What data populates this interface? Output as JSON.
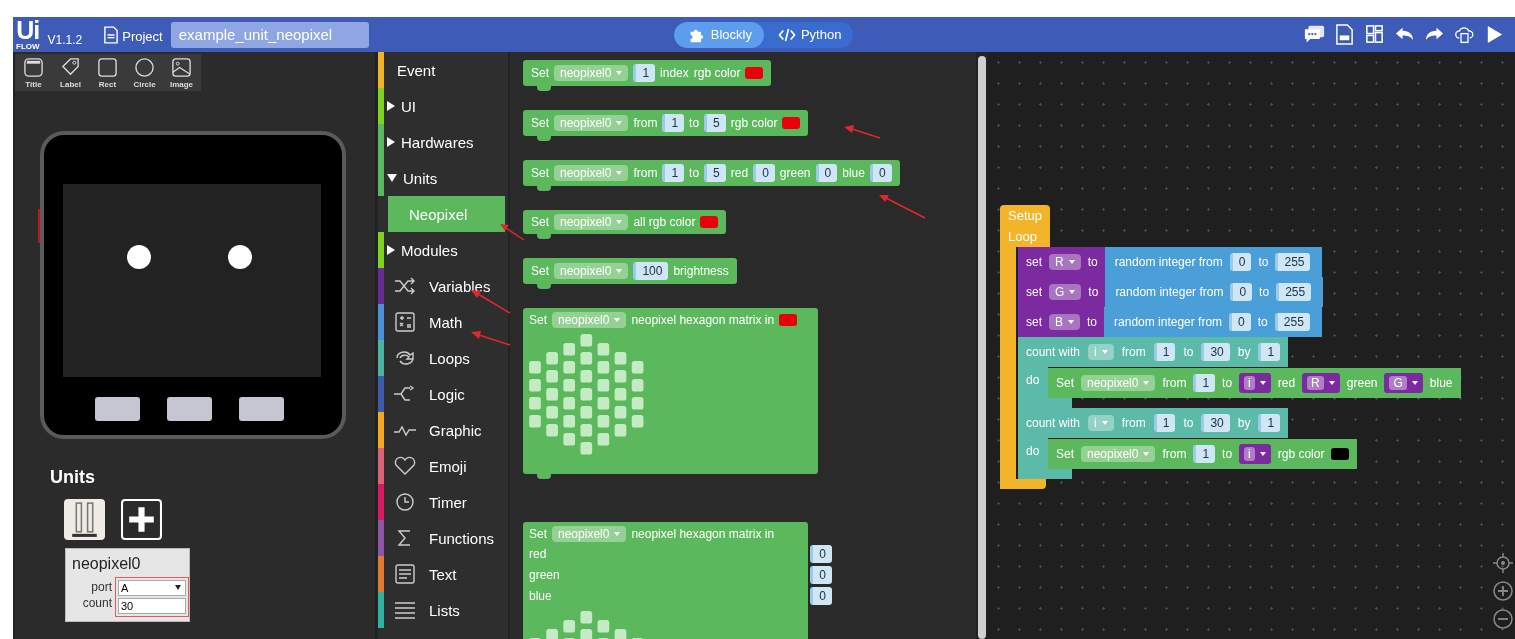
{
  "header": {
    "logo": "Ui",
    "logo_sub": "FLOW",
    "version": "V1.1.2",
    "project_label": "Project",
    "project_name": "example_unit_neopixel",
    "modes": [
      {
        "label": "Blockly",
        "selected": true
      },
      {
        "label": "Python",
        "selected": false
      }
    ]
  },
  "tools": [
    {
      "label": "Title"
    },
    {
      "label": "Label"
    },
    {
      "label": "Rect"
    },
    {
      "label": "Circle"
    },
    {
      "label": "Image"
    }
  ],
  "units": {
    "title": "Units",
    "unit": {
      "name": "neopixel0",
      "port_label": "port",
      "port": "A",
      "count_label": "count",
      "count": "30"
    }
  },
  "categories": [
    {
      "label": "Event",
      "kind": "plain",
      "color": "#f0b429",
      "selected": false
    },
    {
      "label": "UI",
      "kind": "folder",
      "expanded": false,
      "color": "#7ed321",
      "selected": false
    },
    {
      "label": "Hardwares",
      "kind": "folder",
      "expanded": false,
      "color": "#5cb85c",
      "selected": false
    },
    {
      "label": "Units",
      "kind": "folder",
      "expanded": true,
      "color": "#5cb85c",
      "selected": false,
      "children": [
        {
          "label": "Neopixel",
          "selected": true
        }
      ]
    },
    {
      "label": "Modules",
      "kind": "folder",
      "expanded": false,
      "color": "#7ed321",
      "selected": false
    },
    {
      "label": "Variables",
      "kind": "icon",
      "color": "#6a2a94",
      "selected": false
    },
    {
      "label": "Math",
      "kind": "icon",
      "color": "#4a90d9",
      "selected": false
    },
    {
      "label": "Loops",
      "kind": "icon",
      "color": "#4fb3a3",
      "selected": false
    },
    {
      "label": "Logic",
      "kind": "icon",
      "color": "#3e5aa8",
      "selected": false
    },
    {
      "label": "Graphic",
      "kind": "icon",
      "color": "#f5a623",
      "selected": false
    },
    {
      "label": "Emoji",
      "kind": "icon",
      "color": "#d9647a",
      "selected": false
    },
    {
      "label": "Timer",
      "kind": "icon",
      "color": "#d81b60",
      "selected": false
    },
    {
      "label": "Functions",
      "kind": "icon",
      "color": "#8e55a8",
      "selected": false
    },
    {
      "label": "Text",
      "kind": "icon",
      "color": "#e07a30",
      "selected": false
    },
    {
      "label": "Lists",
      "kind": "icon",
      "color": "#2db3a0",
      "selected": false
    }
  ],
  "flyout": [
    {
      "kind": "row",
      "parts": [
        {
          "kind": "text",
          "text": "Set"
        },
        {
          "kind": "dropdown",
          "text": "neopixel0"
        },
        {
          "kind": "number",
          "text": "1"
        },
        {
          "kind": "text",
          "text": "index"
        },
        {
          "kind": "text",
          "text": "rgb color"
        },
        {
          "kind": "color",
          "color": "#e8000b"
        }
      ]
    },
    {
      "kind": "row",
      "parts": [
        {
          "kind": "text",
          "text": "Set"
        },
        {
          "kind": "dropdown",
          "text": "neopixel0"
        },
        {
          "kind": "text",
          "text": "from"
        },
        {
          "kind": "number",
          "text": "1"
        },
        {
          "kind": "text",
          "text": "to"
        },
        {
          "kind": "number",
          "text": "5"
        },
        {
          "kind": "text",
          "text": "rgb color"
        },
        {
          "kind": "color",
          "color": "#e8000b"
        }
      ]
    },
    {
      "kind": "row",
      "parts": [
        {
          "kind": "text",
          "text": "Set"
        },
        {
          "kind": "dropdown",
          "text": "neopixel0"
        },
        {
          "kind": "text",
          "text": "from"
        },
        {
          "kind": "number",
          "text": "1"
        },
        {
          "kind": "text",
          "text": "to"
        },
        {
          "kind": "number",
          "text": "5"
        },
        {
          "kind": "text",
          "text": "red"
        },
        {
          "kind": "number",
          "text": "0"
        },
        {
          "kind": "text",
          "text": "green"
        },
        {
          "kind": "number",
          "text": "0"
        },
        {
          "kind": "text",
          "text": "blue"
        },
        {
          "kind": "number",
          "text": "0"
        }
      ]
    },
    {
      "kind": "row",
      "parts": [
        {
          "kind": "text",
          "text": "Set"
        },
        {
          "kind": "dropdown",
          "text": "neopixel0"
        },
        {
          "kind": "text",
          "text": "all rgb color"
        },
        {
          "kind": "color",
          "color": "#e8000b"
        }
      ]
    },
    {
      "kind": "row",
      "parts": [
        {
          "kind": "text",
          "text": "Set"
        },
        {
          "kind": "dropdown",
          "text": "neopixel0"
        },
        {
          "kind": "number",
          "text": "100"
        },
        {
          "kind": "text",
          "text": "brightness"
        }
      ]
    },
    {
      "kind": "matrix",
      "parts": [
        {
          "kind": "text",
          "text": "Set"
        },
        {
          "kind": "dropdown",
          "text": "neopixel0"
        },
        {
          "kind": "text",
          "text": "neopixel hexagon matrix in"
        },
        {
          "kind": "color",
          "color": "#e8000b"
        }
      ]
    },
    {
      "kind": "matrix",
      "parts": [
        {
          "kind": "text",
          "text": "Set"
        },
        {
          "kind": "dropdown",
          "text": "neopixel0"
        },
        {
          "kind": "text",
          "text": "neopixel hexagon matrix in"
        }
      ],
      "inputs": [
        {
          "label": "red",
          "value": "0"
        },
        {
          "label": "green",
          "value": "0"
        },
        {
          "label": "blue",
          "value": "0"
        }
      ]
    }
  ],
  "program": {
    "hat": "Setup",
    "loop_label": "Loop",
    "statements": [
      {
        "color": "#7b2a9f",
        "parts": [
          {
            "kind": "text",
            "text": "set"
          },
          {
            "kind": "dropdown",
            "text": "R"
          },
          {
            "kind": "text",
            "text": "to"
          },
          {
            "kind": "block",
            "color": "#4a9fd8",
            "parts": [
              {
                "kind": "text",
                "text": "random integer from"
              },
              {
                "kind": "number",
                "text": "0"
              },
              {
                "kind": "text",
                "text": "to"
              },
              {
                "kind": "number",
                "text": "255"
              }
            ]
          }
        ]
      },
      {
        "color": "#7b2a9f",
        "parts": [
          {
            "kind": "text",
            "text": "set"
          },
          {
            "kind": "dropdown",
            "text": "G"
          },
          {
            "kind": "text",
            "text": "to"
          },
          {
            "kind": "block",
            "color": "#4a9fd8",
            "parts": [
              {
                "kind": "text",
                "text": "random integer from"
              },
              {
                "kind": "number",
                "text": "0"
              },
              {
                "kind": "text",
                "text": "to"
              },
              {
                "kind": "number",
                "text": "255"
              }
            ]
          }
        ]
      },
      {
        "color": "#7b2a9f",
        "parts": [
          {
            "kind": "text",
            "text": "set"
          },
          {
            "kind": "dropdown",
            "text": "B"
          },
          {
            "kind": "text",
            "text": "to"
          },
          {
            "kind": "block",
            "color": "#4a9fd8",
            "parts": [
              {
                "kind": "text",
                "text": "random integer from"
              },
              {
                "kind": "number",
                "text": "0"
              },
              {
                "kind": "text",
                "text": "to"
              },
              {
                "kind": "number",
                "text": "255"
              }
            ]
          }
        ]
      },
      {
        "color": "#5bbaa8",
        "parts": [
          {
            "kind": "text",
            "text": "count with"
          },
          {
            "kind": "dropdown",
            "text": "i"
          },
          {
            "kind": "text",
            "text": "from"
          },
          {
            "kind": "number",
            "text": "1"
          },
          {
            "kind": "text",
            "text": "to"
          },
          {
            "kind": "number",
            "text": "30"
          },
          {
            "kind": "text",
            "text": "by"
          },
          {
            "kind": "number",
            "text": "1"
          }
        ],
        "do_label": "do",
        "do": [
          {
            "color": "#5cb85c",
            "parts": [
              {
                "kind": "text",
                "text": "Set"
              },
              {
                "kind": "dropdown",
                "text": "neopixel0"
              },
              {
                "kind": "text",
                "text": "from"
              },
              {
                "kind": "number",
                "text": "1"
              },
              {
                "kind": "text",
                "text": "to"
              },
              {
                "kind": "variable",
                "text": "i"
              },
              {
                "kind": "text",
                "text": "red"
              },
              {
                "kind": "variable",
                "text": "R"
              },
              {
                "kind": "text",
                "text": "green"
              },
              {
                "kind": "variable",
                "text": "G"
              },
              {
                "kind": "text",
                "text": "blue"
              }
            ]
          }
        ]
      },
      {
        "color": "#5bbaa8",
        "parts": [
          {
            "kind": "text",
            "text": "count with"
          },
          {
            "kind": "dropdown",
            "text": "i"
          },
          {
            "kind": "text",
            "text": "from"
          },
          {
            "kind": "number",
            "text": "1"
          },
          {
            "kind": "text",
            "text": "to"
          },
          {
            "kind": "number",
            "text": "30"
          },
          {
            "kind": "text",
            "text": "by"
          },
          {
            "kind": "number",
            "text": "1"
          }
        ],
        "do_label": "do",
        "do": [
          {
            "color": "#5cb85c",
            "parts": [
              {
                "kind": "text",
                "text": "Set"
              },
              {
                "kind": "dropdown",
                "text": "neopixel0"
              },
              {
                "kind": "text",
                "text": "from"
              },
              {
                "kind": "number",
                "text": "1"
              },
              {
                "kind": "text",
                "text": "to"
              },
              {
                "kind": "variable",
                "text": "i"
              },
              {
                "kind": "text",
                "text": "rgb color"
              },
              {
                "kind": "color",
                "color": "#000000"
              }
            ]
          }
        ]
      }
    ]
  }
}
